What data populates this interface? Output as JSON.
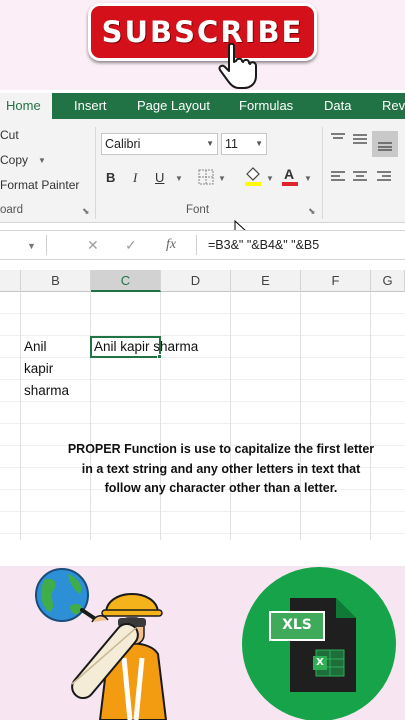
{
  "banner": {
    "subscribe_label": "SUBSCRIBE"
  },
  "ribbon_tabs": [
    "Home",
    "Insert",
    "Page Layout",
    "Formulas",
    "Data",
    "Revi"
  ],
  "clipboard": {
    "cut": "Cut",
    "copy": "Copy",
    "format_painter": "Format Painter",
    "group_label": "oard"
  },
  "font": {
    "name": "Calibri",
    "size": "11",
    "bold": "B",
    "italic": "I",
    "underline": "U",
    "group_label": "Font"
  },
  "formula_bar": {
    "fx": "fx",
    "formula": "=B3&\" \"&B4&\" \"&B5"
  },
  "columns": [
    "B",
    "C",
    "D",
    "E",
    "F",
    "G"
  ],
  "active_column": "C",
  "cells": {
    "b3": "Anil",
    "b4": "kapir",
    "b5": "sharma",
    "c3": "Anil kapir sharma"
  },
  "caption": "PROPER Function is use to capitalize the first letter in a text string and any other letters in text that follow any character other than a letter.",
  "logo": {
    "text": "XLS",
    "sheet_letter": "X"
  },
  "colors": {
    "excel_green": "#217346",
    "subscribe_red": "#d4111b",
    "logo_circle": "#17a34a"
  },
  "icons": [
    "pointing-hand-icon",
    "cut-icon",
    "copy-icon",
    "format-painter-icon",
    "borders-icon",
    "fill-color-icon",
    "font-color-icon",
    "align-top-icon",
    "align-middle-icon",
    "align-bottom-icon",
    "align-left-icon",
    "align-center-icon",
    "align-right-icon",
    "cancel-icon",
    "enter-icon"
  ]
}
